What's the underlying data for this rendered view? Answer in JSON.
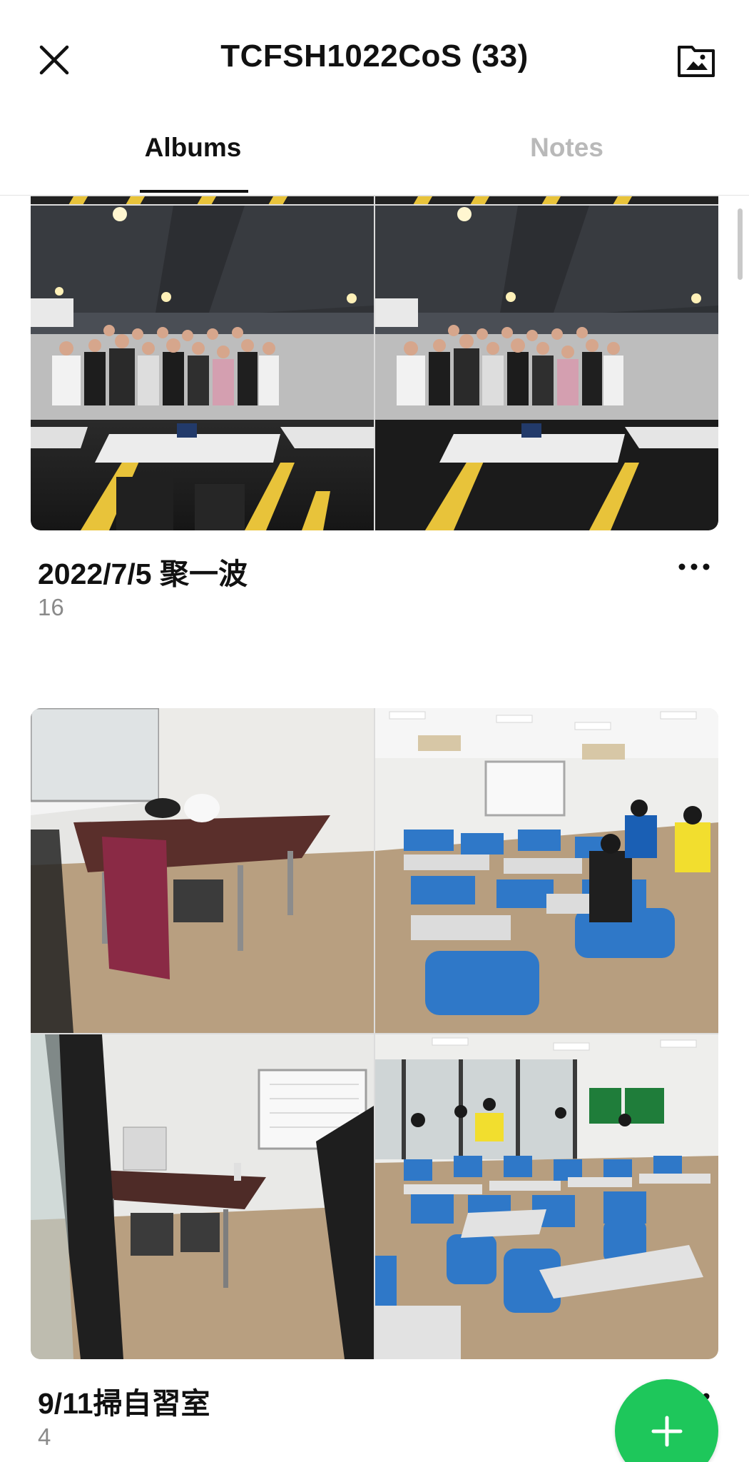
{
  "header": {
    "title": "TCFSH1022CoS (33)",
    "close_icon": "close-icon",
    "add_album_icon": "album-add-icon"
  },
  "tabs": [
    {
      "label": "Albums",
      "active": true
    },
    {
      "label": "Notes",
      "active": false
    }
  ],
  "albums": [
    {
      "name": "2022/7/5 聚一波",
      "count": "16"
    },
    {
      "name": "9/11掃自習室",
      "count": "4"
    }
  ],
  "fab": {
    "icon": "plus-icon",
    "color": "#1ec75b"
  },
  "colors": {
    "accent": "#1ec75b",
    "inactive_tab": "#b9b9b9",
    "count_text": "#8a8a8a"
  }
}
